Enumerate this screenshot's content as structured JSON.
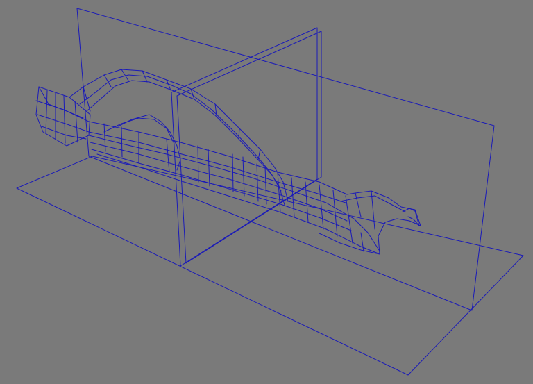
{
  "viewport": {
    "background_color": "#7a7a7a",
    "wire_color": "#1a1ab8",
    "render_mode": "wireframe",
    "objects": [
      {
        "name": "ground-plane",
        "kind": "reference-plane"
      },
      {
        "name": "side-plane",
        "kind": "reference-plane"
      },
      {
        "name": "front-plane",
        "kind": "reference-plane"
      },
      {
        "name": "car-body",
        "kind": "mesh"
      }
    ]
  }
}
